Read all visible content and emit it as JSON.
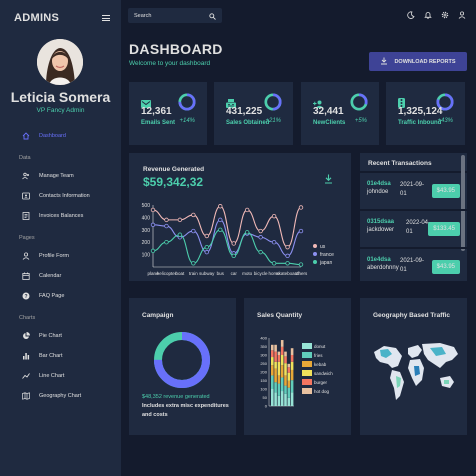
{
  "sidebar": {
    "title": "ADMINS",
    "user_name": "Leticia Somera",
    "user_role": "VP Fancy Admin",
    "items": [
      {
        "label": "Dashboard",
        "icon": "home-icon"
      },
      {
        "section": "Data"
      },
      {
        "label": "Manage Team",
        "icon": "people-icon"
      },
      {
        "label": "Contacts Information",
        "icon": "contacts-icon"
      },
      {
        "label": "Invoices Balances",
        "icon": "receipt-icon"
      },
      {
        "section": "Pages"
      },
      {
        "label": "Profile Form",
        "icon": "person-icon"
      },
      {
        "label": "Calendar",
        "icon": "calendar-icon"
      },
      {
        "label": "FAQ Page",
        "icon": "help-icon"
      },
      {
        "section": "Charts"
      },
      {
        "label": "Pie Chart",
        "icon": "pie-chart-icon"
      },
      {
        "label": "Bar Chart",
        "icon": "bar-chart-icon"
      },
      {
        "label": "Line Chart",
        "icon": "line-chart-icon"
      },
      {
        "label": "Geography Chart",
        "icon": "map-icon"
      }
    ]
  },
  "topbar": {
    "search_placeholder": "Search",
    "icons": [
      "dark-mode-icon",
      "notifications-icon",
      "settings-icon",
      "person-icon"
    ]
  },
  "header": {
    "title": "DASHBOARD",
    "subtitle": "Welcome to your dashboard",
    "download_label": "DOWNLOAD REPORTS"
  },
  "stats": [
    {
      "value": "12,361",
      "label": "Emails Sent",
      "increase": "+14%",
      "progress": 0.75,
      "icon": "email-icon"
    },
    {
      "value": "431,225",
      "label": "Sales Obtained",
      "increase": "+21%",
      "progress": 0.5,
      "icon": "point-of-sale-icon"
    },
    {
      "value": "32,441",
      "label": "NewClients",
      "increase": "+5%",
      "progress": 0.3,
      "icon": "person-add-icon"
    },
    {
      "value": "1,325,124",
      "label": "Traffic Inbound",
      "increase": "+43%",
      "progress": 0.8,
      "icon": "traffic-icon"
    }
  ],
  "revenue": {
    "title": "Revenue Generated",
    "value": "$59,342,32"
  },
  "chart_data": {
    "type": "line",
    "categories": [
      "plane",
      "helicopter",
      "boat",
      "train",
      "subway",
      "bus",
      "car",
      "moto",
      "bicycle",
      "horse",
      "skateboard",
      "others"
    ],
    "ylim": [
      0,
      500
    ],
    "yticks": [
      100,
      200,
      300,
      400,
      500
    ],
    "legend_placement": "right",
    "series": [
      {
        "name": "us",
        "color": "#f1b9b7",
        "values": [
          460,
          380,
          380,
          420,
          250,
          490,
          190,
          460,
          290,
          410,
          160,
          480
        ]
      },
      {
        "name": "france",
        "color": "#8c90f0",
        "values": [
          340,
          330,
          240,
          290,
          120,
          380,
          110,
          270,
          240,
          200,
          90,
          290
        ]
      },
      {
        "name": "japan",
        "color": "#4cceac",
        "values": [
          130,
          200,
          260,
          30,
          160,
          300,
          90,
          280,
          120,
          30,
          30,
          20
        ]
      }
    ]
  },
  "transactions": {
    "title": "Recent Transactions",
    "rows": [
      {
        "id": "01e4dsa",
        "user": "johndoe",
        "date": "2021-09-01",
        "cost": "$43.95"
      },
      {
        "id": "0315dsaa",
        "user": "jackdower",
        "date": "2022-04-01",
        "cost": "$133.45"
      },
      {
        "id": "01e4dsa",
        "user": "aberdohnny",
        "date": "2021-09-01",
        "cost": "$43.95"
      }
    ]
  },
  "campaign": {
    "title": "Campaign",
    "progress": 0.75,
    "revenue_text": "$48,352 revenue generated",
    "note": "Includes extra misc expenditures and costs"
  },
  "sales_quantity": {
    "title": "Sales Quantity",
    "legend": [
      "donut",
      "fries",
      "kebab",
      "sandwich",
      "burger",
      "hot dog"
    ],
    "colors": [
      "#97e3d5",
      "#61cdbb",
      "#e8a838",
      "#f1e15b",
      "#f47560",
      "#e8c1a0"
    ],
    "yticks": [
      "400",
      "350",
      "300",
      "250",
      "200",
      "150",
      "100",
      "50",
      "0"
    ]
  },
  "geography": {
    "title": "Geography Based Traffic"
  }
}
